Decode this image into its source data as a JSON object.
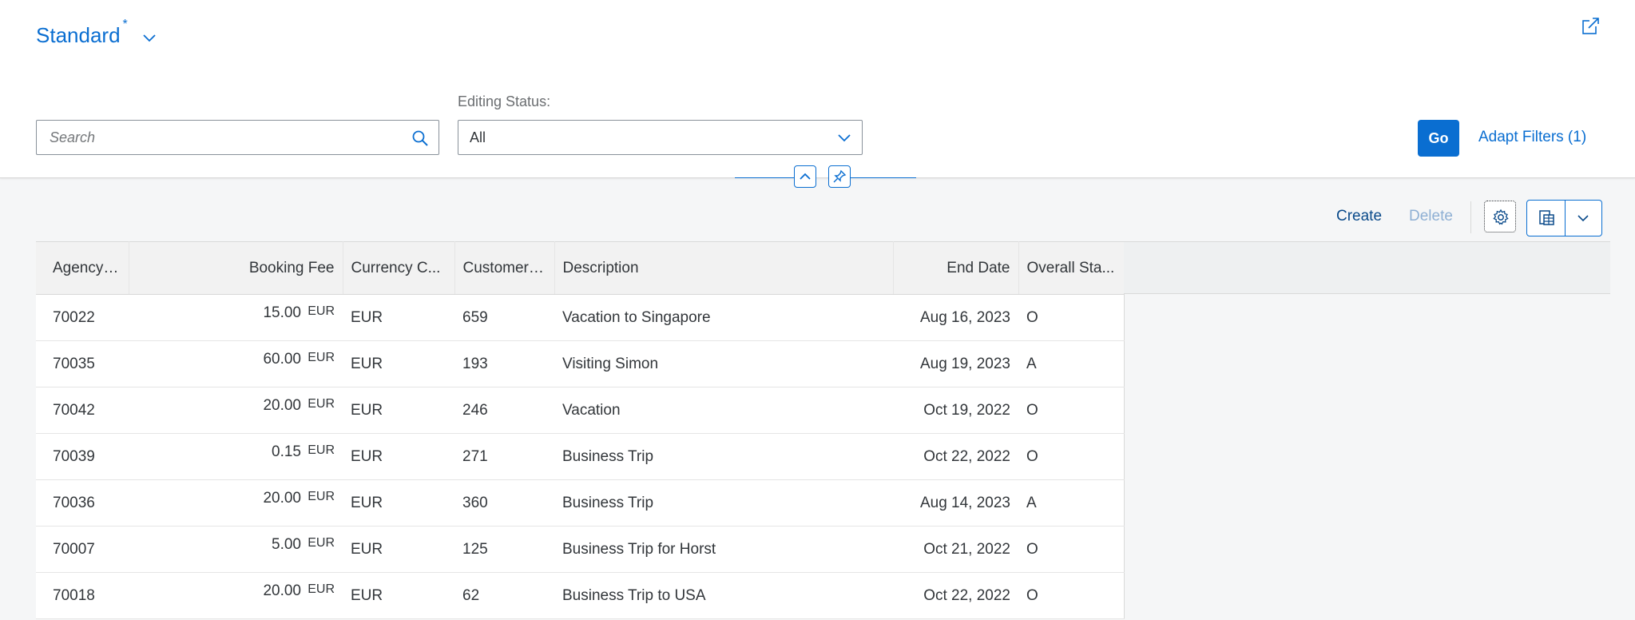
{
  "variant": {
    "title": "Standard",
    "modified_marker": "*"
  },
  "search": {
    "placeholder": "Search",
    "value": ""
  },
  "filter": {
    "label": "Editing Status:",
    "value": "All"
  },
  "actions": {
    "go": "Go",
    "adapt_filters": "Adapt Filters (1)"
  },
  "toolbar": {
    "create": "Create",
    "delete": "Delete"
  },
  "colors": {
    "accent": "#0a6ed1",
    "disabled": "#8fb0d4"
  },
  "table": {
    "columns": [
      "Agency ID",
      "Booking Fee",
      "Currency C...",
      "Customer ID",
      "Description",
      "End Date",
      "Overall Sta..."
    ],
    "rows": [
      {
        "agency": "70022",
        "fee": "15.00",
        "fee_cur": "EUR",
        "currency": "EUR",
        "customer": "659",
        "description": "Vacation to Singapore",
        "end_date": "Aug 16, 2023",
        "status": "O"
      },
      {
        "agency": "70035",
        "fee": "60.00",
        "fee_cur": "EUR",
        "currency": "EUR",
        "customer": "193",
        "description": "Visiting Simon",
        "end_date": "Aug 19, 2023",
        "status": "A"
      },
      {
        "agency": "70042",
        "fee": "20.00",
        "fee_cur": "EUR",
        "currency": "EUR",
        "customer": "246",
        "description": "Vacation",
        "end_date": "Oct 19, 2022",
        "status": "O"
      },
      {
        "agency": "70039",
        "fee": "0.15",
        "fee_cur": "EUR",
        "currency": "EUR",
        "customer": "271",
        "description": "Business Trip",
        "end_date": "Oct 22, 2022",
        "status": "O"
      },
      {
        "agency": "70036",
        "fee": "20.00",
        "fee_cur": "EUR",
        "currency": "EUR",
        "customer": "360",
        "description": "Business Trip",
        "end_date": "Aug 14, 2023",
        "status": "A"
      },
      {
        "agency": "70007",
        "fee": "5.00",
        "fee_cur": "EUR",
        "currency": "EUR",
        "customer": "125",
        "description": "Business Trip for Horst",
        "end_date": "Oct 21, 2022",
        "status": "O"
      },
      {
        "agency": "70018",
        "fee": "20.00",
        "fee_cur": "EUR",
        "currency": "EUR",
        "customer": "62",
        "description": "Business Trip to USA",
        "end_date": "Oct 22, 2022",
        "status": "O"
      }
    ]
  }
}
